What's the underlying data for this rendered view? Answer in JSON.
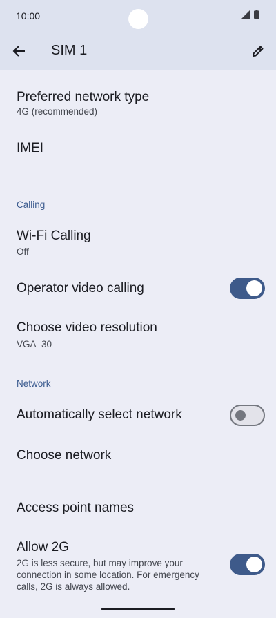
{
  "status": {
    "time": "10:00"
  },
  "appbar": {
    "title": "SIM 1"
  },
  "items": {
    "preferred_network": {
      "title": "Preferred network type",
      "subtitle": "4G (recommended)"
    },
    "imei": {
      "title": "IMEI"
    },
    "calling_header": "Calling",
    "wifi_calling": {
      "title": "Wi-Fi Calling",
      "subtitle": "Off"
    },
    "operator_video": {
      "title": "Operator video calling",
      "state": "on"
    },
    "video_resolution": {
      "title": "Choose video resolution",
      "subtitle": "VGA_30"
    },
    "network_header": "Network",
    "auto_select": {
      "title": "Automatically select network",
      "state": "off"
    },
    "choose_network": {
      "title": "Choose network"
    },
    "apn": {
      "title": "Access point names"
    },
    "allow_2g": {
      "title": "Allow 2G",
      "subtitle": "2G is less secure, but may improve your connection in some location. For emergency calls, 2G is always allowed.",
      "state": "on"
    }
  },
  "colors": {
    "accent": "#3e5a8a",
    "section_header": "#3b5b8f",
    "appbar_bg": "#dde2ef",
    "page_bg": "#ecedf6"
  }
}
